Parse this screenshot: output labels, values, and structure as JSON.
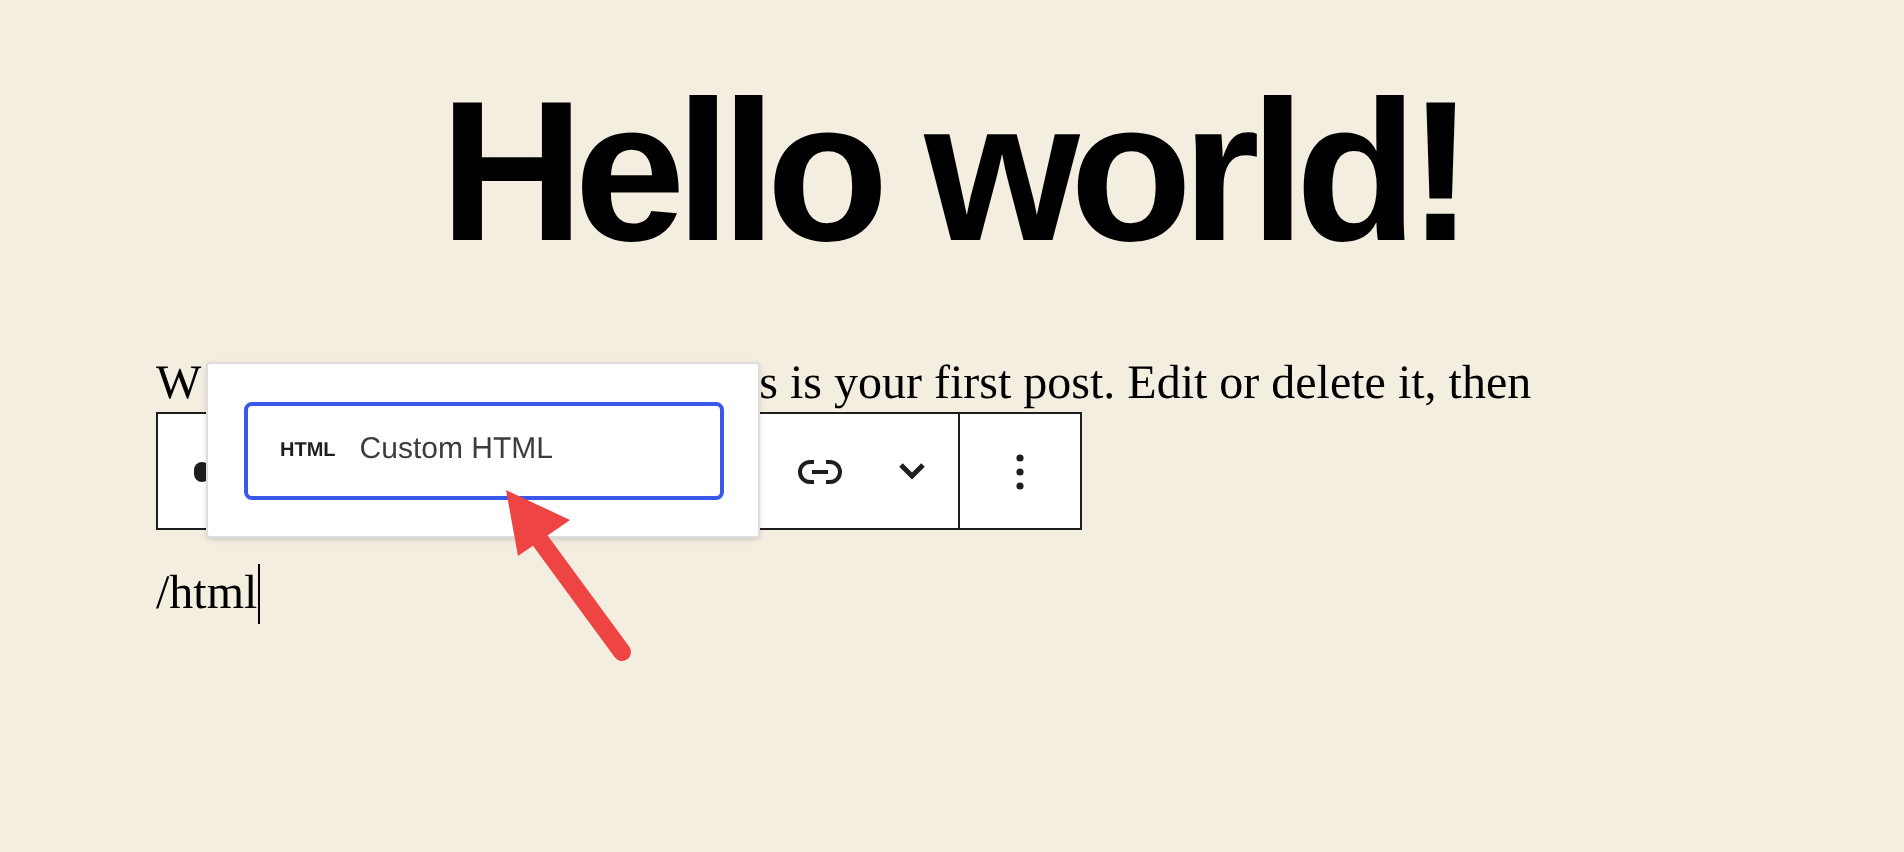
{
  "title": "Hello world!",
  "paragraph": {
    "start": "W",
    "end": "s is your first post. Edit or delete it, then"
  },
  "typed_text": "/html",
  "block_popup": {
    "items": [
      {
        "icon_label": "HTML",
        "label": "Custom HTML",
        "selected": true
      }
    ]
  }
}
